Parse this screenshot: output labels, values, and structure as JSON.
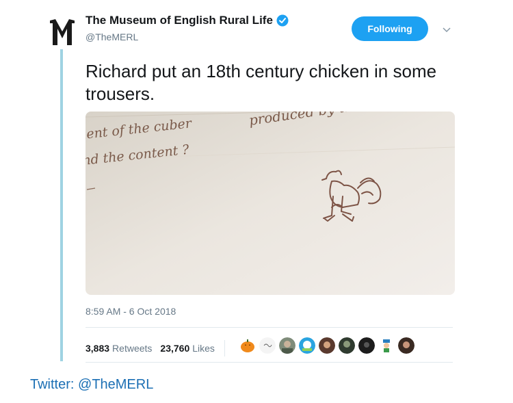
{
  "account": {
    "display_name": "The Museum of English Rural Life",
    "handle": "@TheMERL",
    "verified": true,
    "avatar_letter": "M"
  },
  "follow_button": {
    "label": "Following",
    "color": "#1da1f2"
  },
  "menu_icon": "chevron-down-icon",
  "tweet": {
    "text": "Richard put an 18th century chicken in some trousers.",
    "timestamp": "8:59 AM - 6 Oct 2018"
  },
  "media": {
    "handwriting": {
      "line1": "produced by the ma",
      "line2": "lent of the cuber",
      "line3": "nd the content ?"
    }
  },
  "stats": {
    "retweets_count": "3,883",
    "retweets_label": "Retweets",
    "likes_count": "23,760",
    "likes_label": "Likes"
  },
  "likers": [
    {
      "icon": "pumpkin-avatar"
    },
    {
      "icon": "sketch-avatar"
    },
    {
      "icon": "person-avatar"
    },
    {
      "icon": "blue-character-avatar"
    },
    {
      "icon": "person-avatar"
    },
    {
      "icon": "person-avatar"
    },
    {
      "icon": "dark-avatar"
    },
    {
      "icon": "cartoon-avatar"
    },
    {
      "icon": "person-avatar"
    }
  ],
  "caption": "Twitter: @TheMERL",
  "colors": {
    "thread_line": "#9fd3e2",
    "accent": "#1da1f2",
    "caption": "#1b6fb4",
    "ink": "#6b4a3a"
  }
}
